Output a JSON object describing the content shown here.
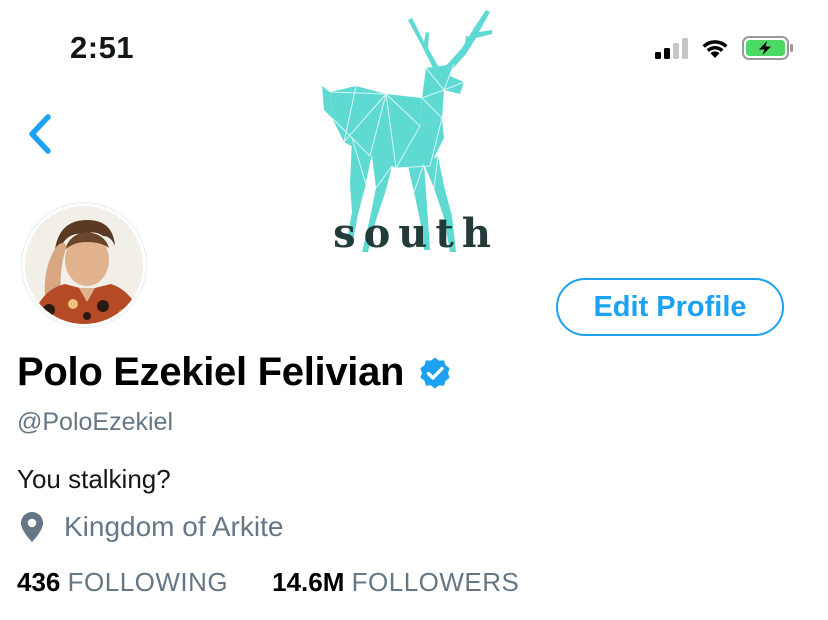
{
  "status_bar": {
    "time": "2:51",
    "icons": [
      "cellular-signal-icon",
      "wifi-icon",
      "battery-charging-icon"
    ],
    "battery_color": "#4cd964"
  },
  "header": {
    "back_icon": "chevron-left-icon",
    "banner": {
      "brand_text": "south",
      "logo_icon": "geometric-deer-icon",
      "logo_color": "#5fdad3"
    }
  },
  "profile": {
    "name": "Polo Ezekiel Felivian",
    "verified_icon": "verified-badge-icon",
    "handle": "@PoloEzekiel",
    "bio": "You stalking?",
    "location_icon": "location-pin-icon",
    "location": "Kingdom of Arkite",
    "edit_button_label": "Edit Profile",
    "stats": {
      "following_count": "436",
      "following_label": "FOLLOWING",
      "followers_count": "14.6M",
      "followers_label": "FOLLOWERS"
    }
  },
  "colors": {
    "accent": "#1da1f2",
    "secondary_text": "#657786",
    "primary_text": "#14171a"
  }
}
